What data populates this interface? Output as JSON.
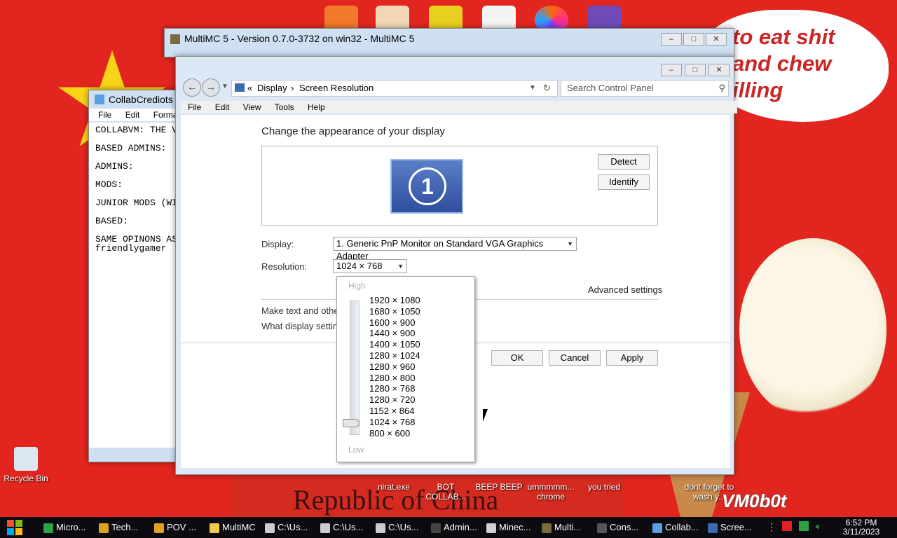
{
  "colors": {
    "desktop_red": "#e2261f",
    "star_yellow": "#f7d417",
    "taskbar": "#0c0c10"
  },
  "desktop": {
    "speech_text": "to eat shit\nand chew\nilling",
    "china_text": "Republic of China",
    "watermark": "VM0b0t",
    "top_icons": [
      "orange-app-icon",
      "user-icon",
      "die-icon",
      "hxd-icon",
      "firefox-icon",
      "cpuz-icon"
    ],
    "icons": [
      {
        "label": "Recycle Bin",
        "icon": "recycle-bin-icon"
      },
      {
        "label": "nirat.exe",
        "icon": "exe-icon"
      },
      {
        "label": "BOT COLLAB...",
        "icon": "file-icon"
      },
      {
        "label": "BEEP BEEP",
        "icon": "file-icon"
      },
      {
        "label": "ummmmm... chrome",
        "icon": "chrome-icon"
      },
      {
        "label": "you tried",
        "icon": "file-icon"
      },
      {
        "label": "dont forget to wash y...",
        "icon": "file-icon"
      }
    ]
  },
  "multimc": {
    "title": "MultiMC 5 - Version 0.7.0-3732 on win32 - MultiMC 5"
  },
  "notepad": {
    "title": "CollabCrediots",
    "menu": [
      "File",
      "Edit",
      "Format"
    ],
    "lines": [
      "COLLABVM: THE V",
      "",
      "BASED ADMINS:",
      "",
      "ADMINS:",
      "",
      "MODS:",
      "",
      "JUNIOR MODS (WI",
      "",
      "BASED:",
      "",
      "SAME OPINONS AS",
      "friendlygamer"
    ]
  },
  "control_panel": {
    "breadcrumb": {
      "sep": "«",
      "display": "Display",
      "arrow": "›",
      "current": "Screen Resolution"
    },
    "search_placeholder": "Search Control Panel",
    "menu": [
      "File",
      "Edit",
      "View",
      "Tools",
      "Help"
    ],
    "heading": "Change the appearance of your display",
    "monitor_number": "1",
    "detect_label": "Detect",
    "identify_label": "Identify",
    "display_label": "Display:",
    "display_value": "1. Generic PnP Monitor on Standard VGA Graphics Adapter",
    "resolution_label": "Resolution:",
    "resolution_value": "1024 × 768",
    "advanced_label": "Advanced settings",
    "link1": "Make text and othe",
    "link2": "What display settin",
    "ok_label": "OK",
    "cancel_label": "Cancel",
    "apply_label": "Apply",
    "dropdown": {
      "high_label": "High",
      "low_label": "Low",
      "items": [
        "1920 × 1080",
        "1680 × 1050",
        "1600 × 900",
        "1440 × 900",
        "1400 × 1050",
        "1280 × 1024",
        "1280 × 960",
        "1280 × 800",
        "1280 × 768",
        "1280 × 720",
        "1152 × 864",
        "1024 × 768",
        "800 × 600"
      ],
      "selected_index": 11
    }
  },
  "taskbar": {
    "items": [
      {
        "label": "Micro...",
        "color": "#2aa34a"
      },
      {
        "label": "Tech...",
        "color": "#e0a020"
      },
      {
        "label": "POV ...",
        "color": "#e0a020"
      },
      {
        "label": "MultiMC",
        "color": "#f2c94c"
      },
      {
        "label": "C:\\Us...",
        "color": "#cccccc"
      },
      {
        "label": "C:\\Us...",
        "color": "#cccccc"
      },
      {
        "label": "C:\\Us...",
        "color": "#cccccc"
      },
      {
        "label": "Admin...",
        "color": "#444444"
      },
      {
        "label": "Minec...",
        "color": "#d0d0d0"
      },
      {
        "label": "Multi...",
        "color": "#7a6a3a"
      },
      {
        "label": "Cons...",
        "color": "#555555"
      },
      {
        "label": "Collab...",
        "color": "#5aa0e0"
      },
      {
        "label": "Scree...",
        "color": "#3a6ab0"
      }
    ],
    "time": "6:52 PM",
    "date": "3/11/2023"
  }
}
